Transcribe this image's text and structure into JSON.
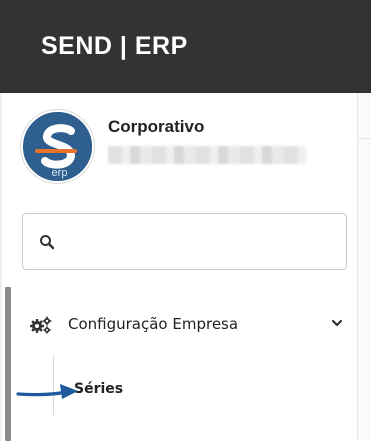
{
  "header": {
    "brand": "SEND | ERP",
    "background": "#333333"
  },
  "profile": {
    "name": "Corporativo",
    "avatar_text": "erp",
    "avatar_color": "#2e5f8f",
    "accent_color": "#e8742c"
  },
  "search": {
    "value": "",
    "icon": "search-icon"
  },
  "menu": {
    "items": [
      {
        "label": "Configuração Empresa",
        "icon": "gears-icon",
        "expanded": true,
        "children": [
          {
            "label": "Séries"
          }
        ]
      }
    ]
  },
  "annotation": {
    "arrow_color": "#1f5a9e"
  }
}
